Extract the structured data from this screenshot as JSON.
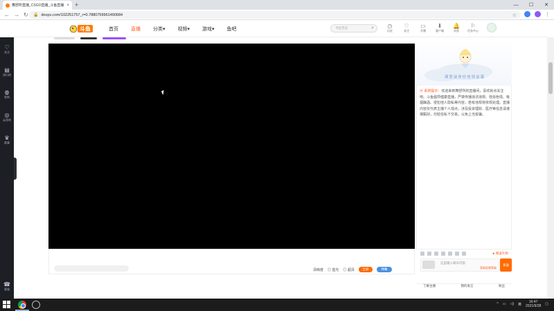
{
  "browser": {
    "tab_title": "舞舒所直播_CSGO直播_斗鱼直播",
    "tab_close": "×",
    "new_tab": "+",
    "url": "douyu.com/102251757_r=0.7880759961490684",
    "nav_back": "←",
    "nav_forward": "→",
    "nav_reload": "↻"
  },
  "site": {
    "logo_text": "斗鱼",
    "menu": [
      "首页",
      "直播",
      "分类▾",
      "视频▾",
      "游戏▾",
      "鱼吧"
    ],
    "active_menu": "直播",
    "search_placeholder": "卡拉无双",
    "top_icons": [
      {
        "name": "history",
        "label": "历史",
        "glyph": "◷"
      },
      {
        "name": "follow",
        "label": "关注",
        "glyph": "♡"
      },
      {
        "name": "video",
        "label": "开播",
        "glyph": "▭"
      },
      {
        "name": "client",
        "label": "客户端",
        "glyph": "⬇"
      },
      {
        "name": "notify",
        "label": "消息",
        "glyph": "🔔"
      },
      {
        "name": "task",
        "label": "任务中心",
        "glyph": "⚐"
      }
    ]
  },
  "sidebar": [
    {
      "name": "follow",
      "label": "关注",
      "glyph": "♡"
    },
    {
      "name": "rank",
      "label": "排行榜",
      "glyph": "▤"
    },
    {
      "name": "shop",
      "label": "鱼购",
      "glyph": "◍"
    },
    {
      "name": "game",
      "label": "云游戏",
      "glyph": "◎"
    },
    {
      "name": "cup",
      "label": "赛事",
      "glyph": "♛"
    },
    {
      "name": "help",
      "label": "客服",
      "glyph": "☎"
    }
  ],
  "player": {
    "clarity_label": "清晰度",
    "opt1": "蓝光",
    "opt2": "超清",
    "btn1": "全屏",
    "btn2": "弹幕"
  },
  "chat": {
    "banner_text": "课室谜身份信别金蛋",
    "system_tag": "系统提示：",
    "system_message": "欢迎来到舞舒所的直播间，喜欢就点关注吧。斗鱼倡导健康直播，严禁传播违法违规、低俗色情、吸烟酗酒、侵犯他人隐私等内容，若有违规将依规处理。直播内容仅代表主播个人观点，涉及投资理财、医疗等信息请谨慎甄别，勿轻信私下交易，以免上当受骗。",
    "gift_hint": "赠送礼物",
    "input_placeholder": "这里输入聊天内容",
    "input_level": "获取权限等级",
    "send_label": "发送",
    "bottom_tabs": [
      "了解主播",
      "我的发言",
      "粉丝"
    ]
  },
  "taskbar": {
    "time": "16:47",
    "date": "2021/9/28",
    "lang": "英"
  }
}
